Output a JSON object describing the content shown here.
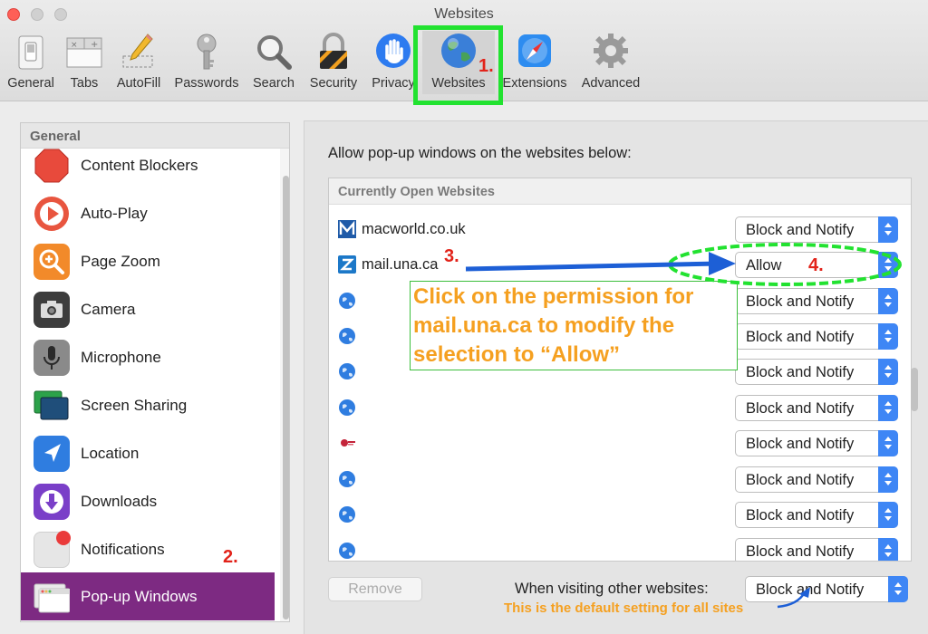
{
  "window": {
    "title": "Websites"
  },
  "toolbar": {
    "items": [
      {
        "label": "General",
        "icon": "general-switch-icon"
      },
      {
        "label": "Tabs",
        "icon": "tabs-icon"
      },
      {
        "label": "AutoFill",
        "icon": "autofill-pencil-icon"
      },
      {
        "label": "Passwords",
        "icon": "key-icon"
      },
      {
        "label": "Search",
        "icon": "magnifier-icon"
      },
      {
        "label": "Security",
        "icon": "padlock-icon"
      },
      {
        "label": "Privacy",
        "icon": "hand-icon"
      },
      {
        "label": "Websites",
        "icon": "globe-icon",
        "selected": true
      },
      {
        "label": "Extensions",
        "icon": "compass-icon"
      },
      {
        "label": "Advanced",
        "icon": "gear-icon"
      }
    ]
  },
  "sidebar": {
    "header": "General",
    "items": [
      {
        "label": "Content Blockers",
        "icon": "stop-sign-icon"
      },
      {
        "label": "Auto-Play",
        "icon": "play-icon"
      },
      {
        "label": "Page Zoom",
        "icon": "zoom-icon"
      },
      {
        "label": "Camera",
        "icon": "camera-icon"
      },
      {
        "label": "Microphone",
        "icon": "microphone-icon"
      },
      {
        "label": "Screen Sharing",
        "icon": "screen-sharing-icon"
      },
      {
        "label": "Location",
        "icon": "location-arrow-icon"
      },
      {
        "label": "Downloads",
        "icon": "download-icon"
      },
      {
        "label": "Notifications",
        "icon": "notifications-icon"
      },
      {
        "label": "Pop-up Windows",
        "icon": "popup-windows-icon",
        "selected": true
      }
    ]
  },
  "main": {
    "heading": "Allow pop-up windows on the websites below:",
    "list_header": "Currently Open Websites",
    "rows": [
      {
        "site": "macworld.co.uk",
        "favicon": "macworld-m-icon",
        "setting": "Block and Notify"
      },
      {
        "site": "mail.una.ca",
        "favicon": "zimbra-z-icon",
        "setting": "Allow"
      },
      {
        "site": "",
        "favicon": "globe-favicon",
        "setting": "Block and Notify"
      },
      {
        "site": "",
        "favicon": "globe-favicon",
        "setting": "Block and Notify"
      },
      {
        "site": "",
        "favicon": "globe-favicon",
        "setting": "Block and Notify"
      },
      {
        "site": "",
        "favicon": "globe-favicon",
        "setting": "Block and Notify"
      },
      {
        "site": "",
        "favicon": "red-logo-favicon",
        "setting": "Block and Notify"
      },
      {
        "site": "",
        "favicon": "globe-favicon",
        "setting": "Block and Notify"
      },
      {
        "site": "",
        "favicon": "globe-favicon",
        "setting": "Block and Notify"
      },
      {
        "site": "",
        "favicon": "globe-favicon",
        "setting": "Block and Notify"
      }
    ],
    "remove_label": "Remove",
    "other_sites_label": "When visiting other websites:",
    "other_sites_value": "Block and Notify"
  },
  "annotations": {
    "step1": "1.",
    "step2": "2.",
    "step3": "3.",
    "step4": "4.",
    "instruction": "Click on the permission for mail.una.ca to modify the selection to “Allow”",
    "default_note": "This is the default setting for all sites"
  },
  "colors": {
    "selected_sidebar": "#7d2a82",
    "highlight_green": "#22e230",
    "annotation_orange": "#f5a020",
    "annotation_red": "#e2231a",
    "arrow_blue": "#1d5fd6",
    "popup_blue": "#3e86f5"
  }
}
